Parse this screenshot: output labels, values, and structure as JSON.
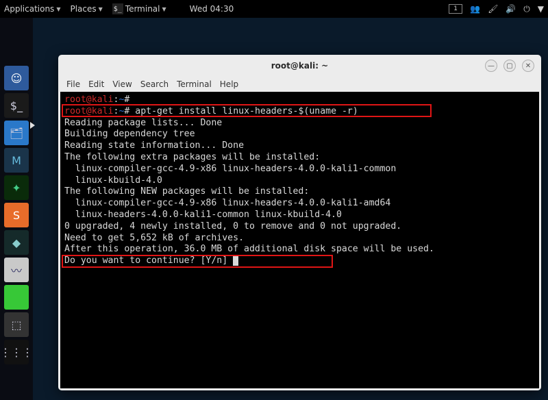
{
  "panel": {
    "applications": "Applications",
    "places": "Places",
    "active_app_icon": "$_",
    "active_app": "Terminal",
    "clock": "Wed 04:30",
    "workspace": "1"
  },
  "window": {
    "title": "root@kali: ~",
    "menu": {
      "file": "File",
      "edit": "Edit",
      "view": "View",
      "search": "Search",
      "terminal": "Terminal",
      "help": "Help"
    }
  },
  "prompt": {
    "user": "root",
    "host": "kali",
    "path": "~",
    "symbol": "#"
  },
  "cmd": " apt-get install linux-headers-$(uname -r)",
  "out": {
    "l1": "Reading package lists... Done",
    "l2": "Building dependency tree       ",
    "l3": "Reading state information... Done",
    "l4": "The following extra packages will be installed:",
    "l5": "  linux-compiler-gcc-4.9-x86 linux-headers-4.0.0-kali1-common",
    "l6": "  linux-kbuild-4.0",
    "l7": "The following NEW packages will be installed:",
    "l8": "  linux-compiler-gcc-4.9-x86 linux-headers-4.0.0-kali1-amd64",
    "l9": "  linux-headers-4.0.0-kali1-common linux-kbuild-4.0",
    "l10": "0 upgraded, 4 newly installed, 0 to remove and 0 not upgraded.",
    "l11": "Need to get 5,652 kB of archives.",
    "l12": "After this operation, 36.0 MB of additional disk space will be used.",
    "l13": "Do you want to continue? [Y/n] "
  }
}
